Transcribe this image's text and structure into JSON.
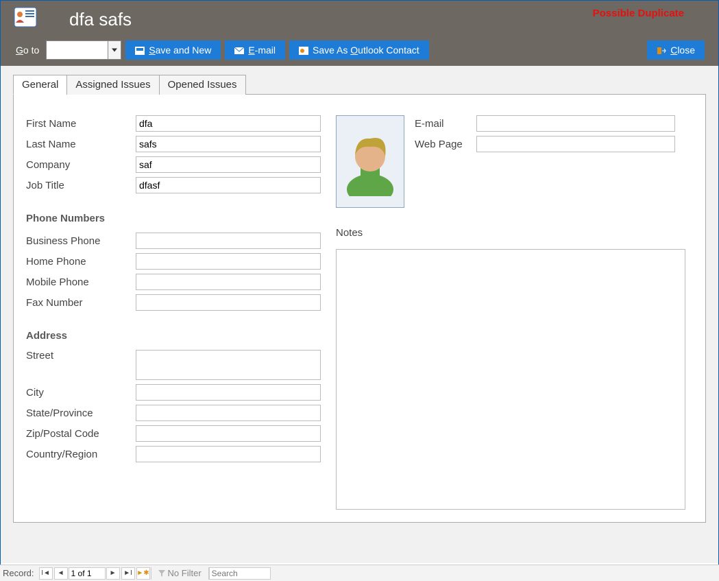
{
  "header": {
    "title": "dfa safs",
    "duplicate_warning": "Possible Duplicate"
  },
  "toolbar": {
    "goto_label_pre": "G",
    "goto_label_post": "o to",
    "goto_value": "",
    "save_and_new_pre": "S",
    "save_and_new_post": "ave and New",
    "email_pre": "E",
    "email_post": "-mail",
    "save_outlook_pre": "Save As ",
    "save_outlook_u": "O",
    "save_outlook_post": "utlook Contact",
    "close_pre": "C",
    "close_post": "lose"
  },
  "tabs": {
    "general": "General",
    "assigned": "Assigned Issues",
    "opened": "Opened Issues"
  },
  "labels": {
    "first_name": "First Name",
    "last_name": "Last Name",
    "company": "Company",
    "job_title": "Job Title",
    "phone_section": "Phone Numbers",
    "business_phone": "Business Phone",
    "home_phone": "Home Phone",
    "mobile_phone": "Mobile Phone",
    "fax_number": "Fax Number",
    "address_section": "Address",
    "street": "Street",
    "city": "City",
    "state": "State/Province",
    "zip": "Zip/Postal Code",
    "country": "Country/Region",
    "email": "E-mail",
    "webpage": "Web Page",
    "notes": "Notes"
  },
  "values": {
    "first_name": "dfa",
    "last_name": "safs",
    "company": "saf",
    "job_title": "dfasf",
    "business_phone": "",
    "home_phone": "",
    "mobile_phone": "",
    "fax_number": "",
    "street": "",
    "city": "",
    "state": "",
    "zip": "",
    "country": "",
    "email": "",
    "webpage": "",
    "notes": ""
  },
  "statusbar": {
    "record_label": "Record:",
    "record_value": "1 of 1",
    "no_filter": "No Filter",
    "search_placeholder": "Search"
  }
}
